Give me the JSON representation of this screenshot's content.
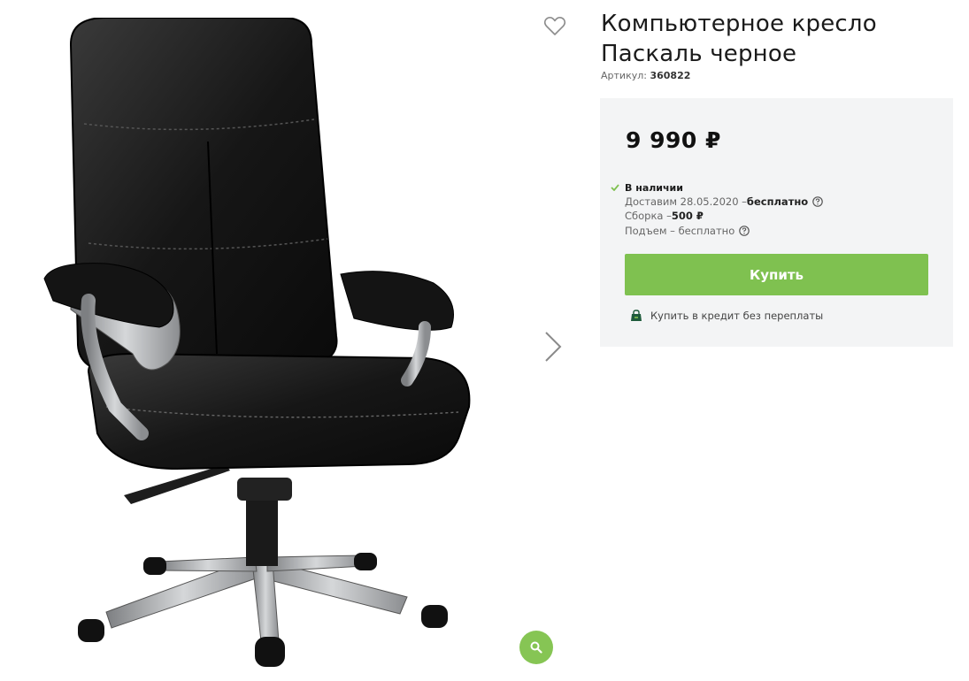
{
  "product": {
    "title_line1": "Компьютерное кресло",
    "title_line2": "Паскаль черное",
    "sku_label": "Артикул:",
    "sku_value": "360822",
    "image_alt": "Компьютерное кресло Паскаль черное",
    "color": "black"
  },
  "purchase": {
    "price": "9 990 ₽",
    "stock": "В наличии",
    "delivery_prefix": "Доставим 28.05.2020 – ",
    "delivery_value": "бесплатно",
    "assembly_prefix": "Сборка – ",
    "assembly_value": "500 ₽",
    "lift_text": "Подъем – бесплатно",
    "buy_label": "Купить",
    "credit_label": "Купить в кредит без переплаты"
  },
  "icons": {
    "favorite": "heart-icon",
    "next": "chevron-right-icon",
    "zoom": "magnifier-icon",
    "stock": "check-icon",
    "help": "question-icon",
    "credit": "bag-icon"
  },
  "colors": {
    "accent": "#7fc150",
    "panel": "#f3f4f5"
  }
}
